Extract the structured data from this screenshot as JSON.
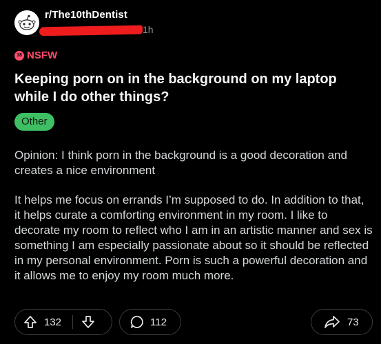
{
  "post": {
    "subreddit": "r/The10thDentist",
    "time_ago": "1h",
    "nsfw_label": "NSFW",
    "nsfw_badge": "18",
    "title": "Keeping porn on in the background on my laptop while I do other things?",
    "flair": "Other",
    "body": [
      "Opinion: I think porn in the background is a good decoration and creates a nice environment",
      "It helps me focus on errands I’m supposed to do. In addition to that, it helps curate a comforting environment in my room. I like to decorate my room to reflect who I am in an artistic manner and sex is something I am especially passionate about so it should be reflected in my personal environment. Porn is such a powerful decoration and it allows me to enjoy my room much more."
    ]
  },
  "actions": {
    "upvotes": "132",
    "comments": "112",
    "shares": "73"
  },
  "colors": {
    "background": "#000000",
    "nsfw": "#ff4d6a",
    "flair": "#3fbf63",
    "redaction": "#ee1c1c"
  },
  "icons": {
    "avatar": "subreddit-avatar-icon",
    "upvote": "arrow-up-icon",
    "downvote": "arrow-down-icon",
    "comment": "comment-bubble-icon",
    "share": "share-arrow-icon"
  }
}
